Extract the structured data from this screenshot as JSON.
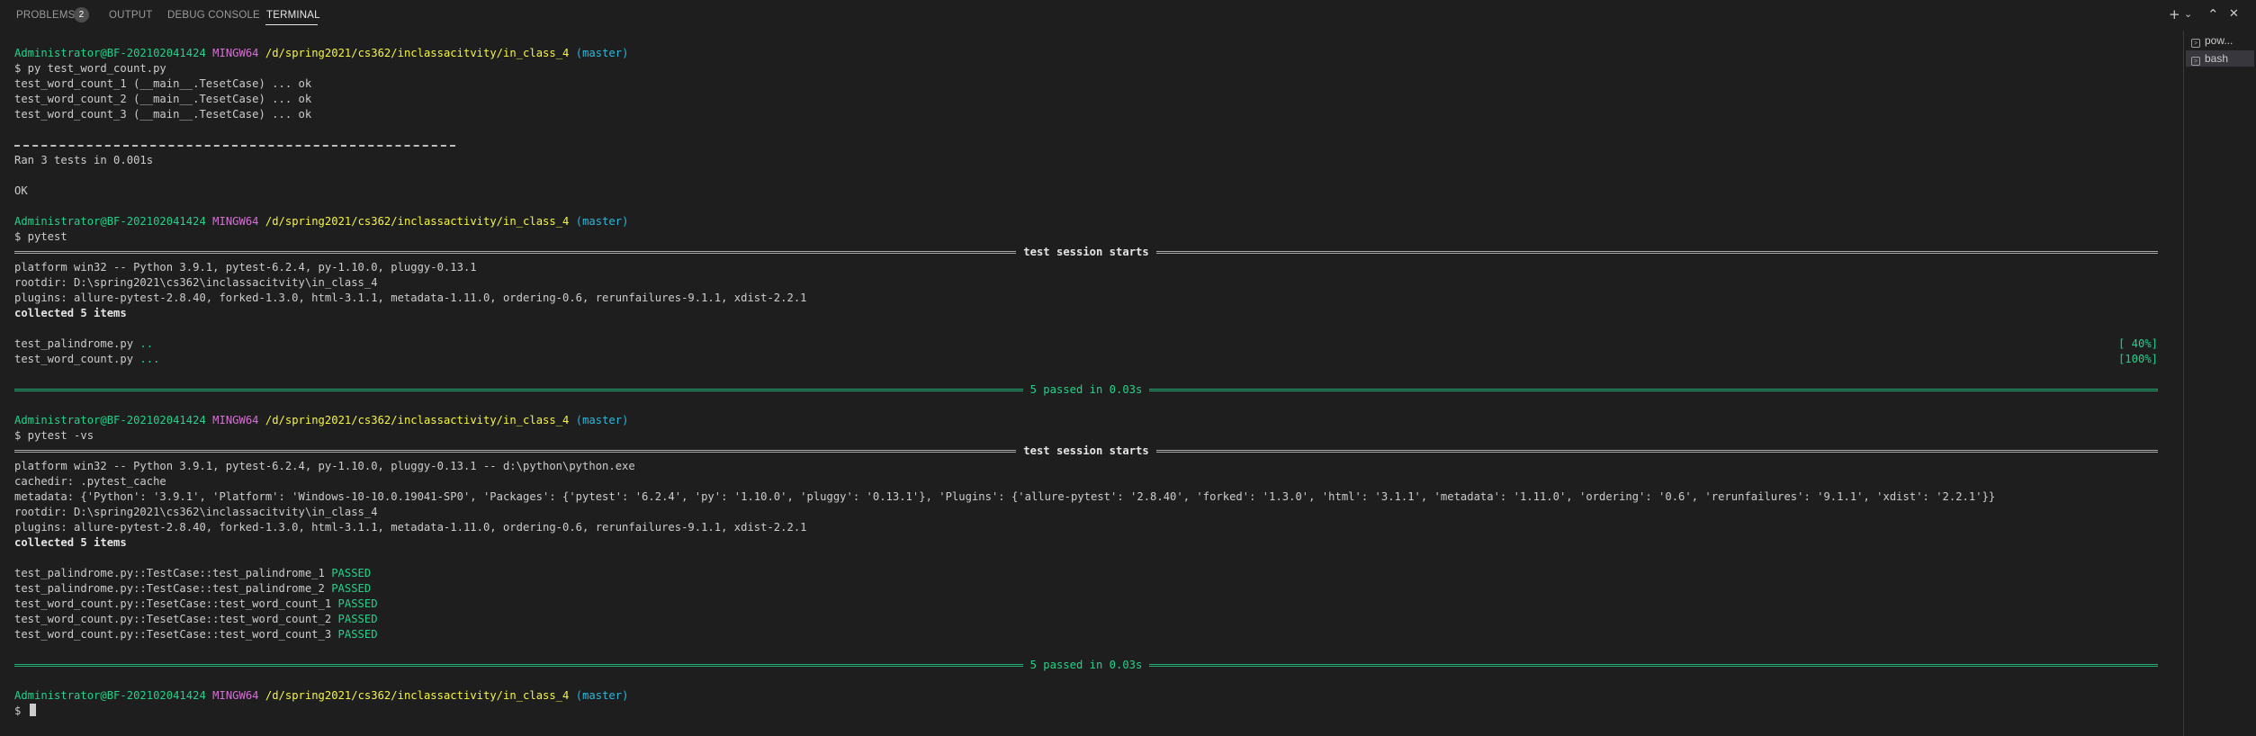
{
  "panel": {
    "tabs": [
      {
        "label": "PROBLEMS",
        "active": false
      },
      {
        "label": "OUTPUT",
        "active": false
      },
      {
        "label": "DEBUG CONSOLE",
        "active": false
      },
      {
        "label": "TERMINAL",
        "active": true
      }
    ],
    "problems_count": "2",
    "controls": {
      "add": "+",
      "split": "⌄",
      "maximize": "⌃",
      "close": "✕"
    }
  },
  "terminals": [
    {
      "label": "pow...",
      "icon": "terminal-icon",
      "active": false
    },
    {
      "label": "bash",
      "icon": "terminal-icon",
      "active": true
    }
  ],
  "prompt": {
    "user": "Administrator@BF-202102041424",
    "env": "MINGW64",
    "branch": "(master)",
    "dir1": "/d/spring2021/cs362/inclassacitvity/in_class_4",
    "dir2": "/d/spring2021/cs362/inclassactivity/in_class_4"
  },
  "output": {
    "cmd1": "$ py test_word_count.py",
    "u1": "test_word_count_1 (__main__.TesetCase) ... ok",
    "u2": "test_word_count_2 (__main__.TesetCase) ... ok",
    "u3": "test_word_count_3 (__main__.TesetCase) ... ok",
    "ran": "Ran 3 tests in 0.001s",
    "ok": "OK",
    "cmd2": "$ pytest",
    "session_starts": "test session starts",
    "platform1": "platform win32 -- Python 3.9.1, pytest-6.2.4, py-1.10.0, pluggy-0.13.1",
    "rootdir": "rootdir: D:\\spring2021\\cs362\\inclassacitvity\\in_class_4",
    "plugins": "plugins: allure-pytest-2.8.40, forked-1.3.0, html-3.1.1, metadata-1.11.0, ordering-0.6, rerunfailures-9.1.1, xdist-2.2.1",
    "collected": "collected 5 items",
    "file1": "test_palindrome.py ",
    "file1_dots": "..",
    "file1_pct": "[ 40%]",
    "file2": "test_word_count.py ",
    "file2_dots": "...",
    "file2_pct": "[100%]",
    "passed_summary": "5 passed in 0.03s",
    "cmd3": "$ pytest -vs",
    "platform2": "platform win32 -- Python 3.9.1, pytest-6.2.4, py-1.10.0, pluggy-0.13.1 -- d:\\python\\python.exe",
    "cachedir": "cachedir: .pytest_cache",
    "metadata": "metadata: {'Python': '3.9.1', 'Platform': 'Windows-10-10.0.19041-SP0', 'Packages': {'pytest': '6.2.4', 'py': '1.10.0', 'pluggy': '0.13.1'}, 'Plugins': {'allure-pytest': '2.8.40', 'forked': '1.3.0', 'html': '3.1.1', 'metadata': '1.11.0', 'ordering': '0.6', 'rerunfailures': '9.1.1', 'xdist': '2.2.1'}}",
    "passed_label": "PASSED",
    "v1": "test_palindrome.py::TestCase::test_palindrome_1 ",
    "v2": "test_palindrome.py::TestCase::test_palindrome_2 ",
    "v3": "test_word_count.py::TesetCase::test_word_count_1 ",
    "v4": "test_word_count.py::TesetCase::test_word_count_2 ",
    "v5": "test_word_count.py::TesetCase::test_word_count_3 ",
    "final_prompt": "$ "
  },
  "colors": {
    "background": "#1e1e1e",
    "text": "#cccccc",
    "green": "#23d18b",
    "magenta": "#d670d6",
    "yellow": "#f5f543",
    "cyan": "#29b8db"
  }
}
